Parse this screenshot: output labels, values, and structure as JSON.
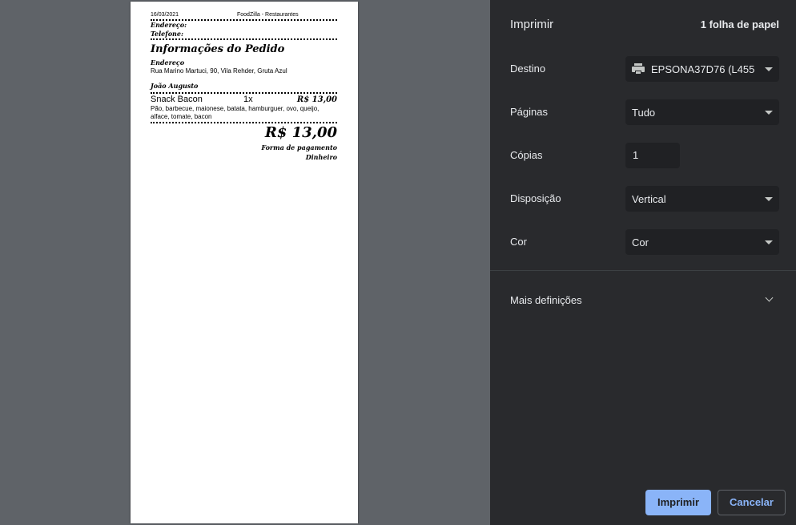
{
  "receipt": {
    "date": "16/03/2021",
    "restaurant": "FoodZilla - Restaurantes",
    "address_label": "Endereço:",
    "phone_label": "Telefone:",
    "order_info_title": "Informações do Pedido",
    "delivery_address_label": "Endereço",
    "delivery_address": "Rua Marino Martuci, 90, Vila Rehder, Gruta Azul",
    "customer_name": "João Augusto",
    "item": {
      "name": "Snack Bacon",
      "qty": "1x",
      "price": "R$ 13,00",
      "description": "Pão, barbecue, maionese, batata, hamburguer, ovo, queijo, alface, tomate, bacon"
    },
    "total": "R$ 13,00",
    "payment_label": "Forma de pagamento",
    "payment_method": "Dinheiro"
  },
  "panel": {
    "title": "Imprimir",
    "sheets": "1 folha de papel",
    "destination_label": "Destino",
    "destination_value": "EPSONA37D76 (L455",
    "pages_label": "Páginas",
    "pages_value": "Tudo",
    "copies_label": "Cópias",
    "copies_value": "1",
    "layout_label": "Disposição",
    "layout_value": "Vertical",
    "color_label": "Cor",
    "color_value": "Cor",
    "more_settings": "Mais definições",
    "print_button": "Imprimir",
    "cancel_button": "Cancelar"
  }
}
